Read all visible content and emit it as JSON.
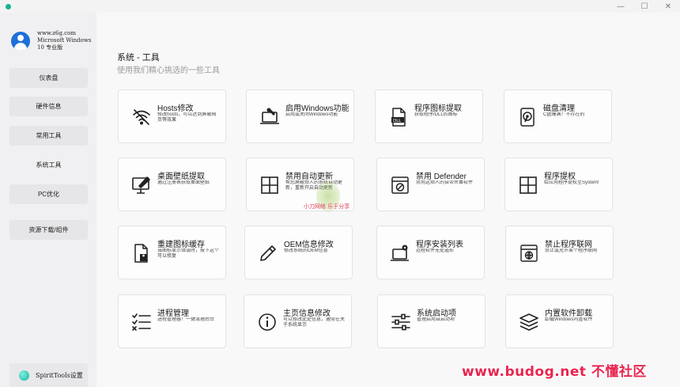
{
  "window": {
    "minimize_glyph": "—",
    "maximize_glyph": "☐",
    "close_glyph": "✕"
  },
  "profile": {
    "site": "www.z6g.com",
    "os_line1": "Microsoft Windows",
    "os_line2": "10 专业版"
  },
  "sidebar": {
    "items": [
      {
        "label": "仪表盘"
      },
      {
        "label": "硬件信息"
      },
      {
        "label": "常用工具"
      },
      {
        "label": "系统工具"
      },
      {
        "label": "PC优化"
      },
      {
        "label": "资源下载/组件"
      }
    ],
    "active_index": 3,
    "settings_label": "SpiritTools设置"
  },
  "page": {
    "title": "系统 - 工具",
    "subtitle": "使用我们精心挑选的一些工具"
  },
  "cards": [
    {
      "title": "Hosts修改",
      "desc": "修改hosts，可以达到屏蔽网页等效果",
      "icon": "wifi-icon"
    },
    {
      "title": "启用Windows功能",
      "desc": "启用或关闭Windows功能",
      "icon": "laptop-wrench-icon"
    },
    {
      "title": "程序图标提取",
      "desc": "获取程序/DLL的图标",
      "icon": "dll-file-icon"
    },
    {
      "title": "磁盘清理",
      "desc": "C盘爆满？不存在的",
      "icon": "disk-icon"
    },
    {
      "title": "桌面壁纸提取",
      "desc": "通过注册表获取桌面壁纸",
      "icon": "monitor-edit-icon"
    },
    {
      "title": "禁用自动更新",
      "desc": "帮您屏蔽烦人的系统自动更新，重新开启自动更新",
      "icon": "windows-logo-icon"
    },
    {
      "title": "禁用 Defender",
      "desc": "禁用这烦人的自带杀毒软件",
      "icon": "block-window-icon"
    },
    {
      "title": "程序提权",
      "desc": "给应用程序提权至System!",
      "icon": "windows-logo-icon"
    },
    {
      "title": "重建图标缓存",
      "desc": "当图标显示错误时，按下这个可以修复",
      "icon": "file-rebuild-icon"
    },
    {
      "title": "OEM信息修改",
      "desc": "修改系统的OEM信息",
      "icon": "pencil-icon"
    },
    {
      "title": "程序安装列表",
      "desc": "远程软件无处遁形",
      "icon": "laptop-gear-icon"
    },
    {
      "title": "禁止程序联网",
      "desc": "禁止或允许某个程序联网",
      "icon": "globe-window-icon"
    },
    {
      "title": "进程管理",
      "desc": "进程管理器！一键清理后台",
      "icon": "checklist-icon"
    },
    {
      "title": "主页信息修改",
      "desc": "可以修改此处信息，通常在关于系统显示",
      "icon": "info-icon"
    },
    {
      "title": "系统启动项",
      "desc": "管理启用自启动项",
      "icon": "sliders-icon"
    },
    {
      "title": "内置软件卸载",
      "desc": "卸载Windows内置软件",
      "icon": "layers-icon"
    }
  ],
  "watermark": {
    "bottom": "www.budog.net 不懂社区",
    "center": "小刀网络 乐于分享"
  }
}
